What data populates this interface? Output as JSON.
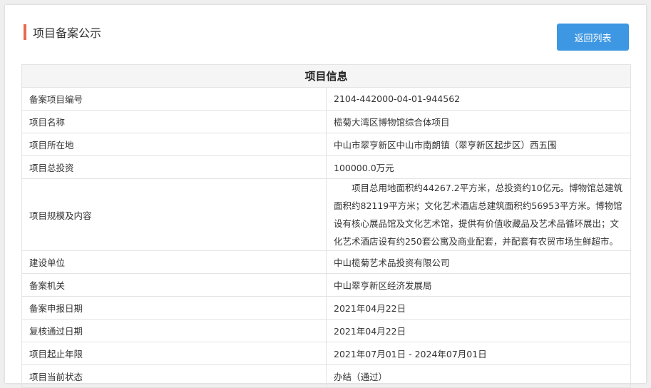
{
  "header": {
    "title": "项目备案公示",
    "back_label": "返回列表"
  },
  "table": {
    "heading": "项目信息",
    "rows": [
      {
        "label": "备案项目编号",
        "value": "2104-442000-04-01-944562"
      },
      {
        "label": "项目名称",
        "value": "榄菊大湾区博物馆综合体项目"
      },
      {
        "label": "项目所在地",
        "value": "中山市翠亨新区中山市南朗镇（翠亨新区起步区）西五围"
      },
      {
        "label": "项目总投资",
        "value": "100000.0万元"
      },
      {
        "label": "项目规模及内容",
        "value": "项目总用地面积约44267.2平方米，总投资约10亿元。博物馆总建筑面积约82119平方米；文化艺术酒店总建筑面积约56953平方米。博物馆设有核心展品馆及文化艺术馆，提供有价值收藏品及艺术品循环展出；文化艺术酒店设有约250套公寓及商业配套，并配套有农贸市场生鲜超市。"
      },
      {
        "label": "建设单位",
        "value": "中山榄菊艺术品投资有限公司"
      },
      {
        "label": "备案机关",
        "value": "中山翠亨新区经济发展局"
      },
      {
        "label": "备案申报日期",
        "value": "2021年04月22日"
      },
      {
        "label": "复核通过日期",
        "value": "2021年04月22日"
      },
      {
        "label": "项目起止年限",
        "value": "2021年07月01日 - 2024年07月01日"
      },
      {
        "label": "项目当前状态",
        "value": "办结（通过）"
      }
    ]
  }
}
